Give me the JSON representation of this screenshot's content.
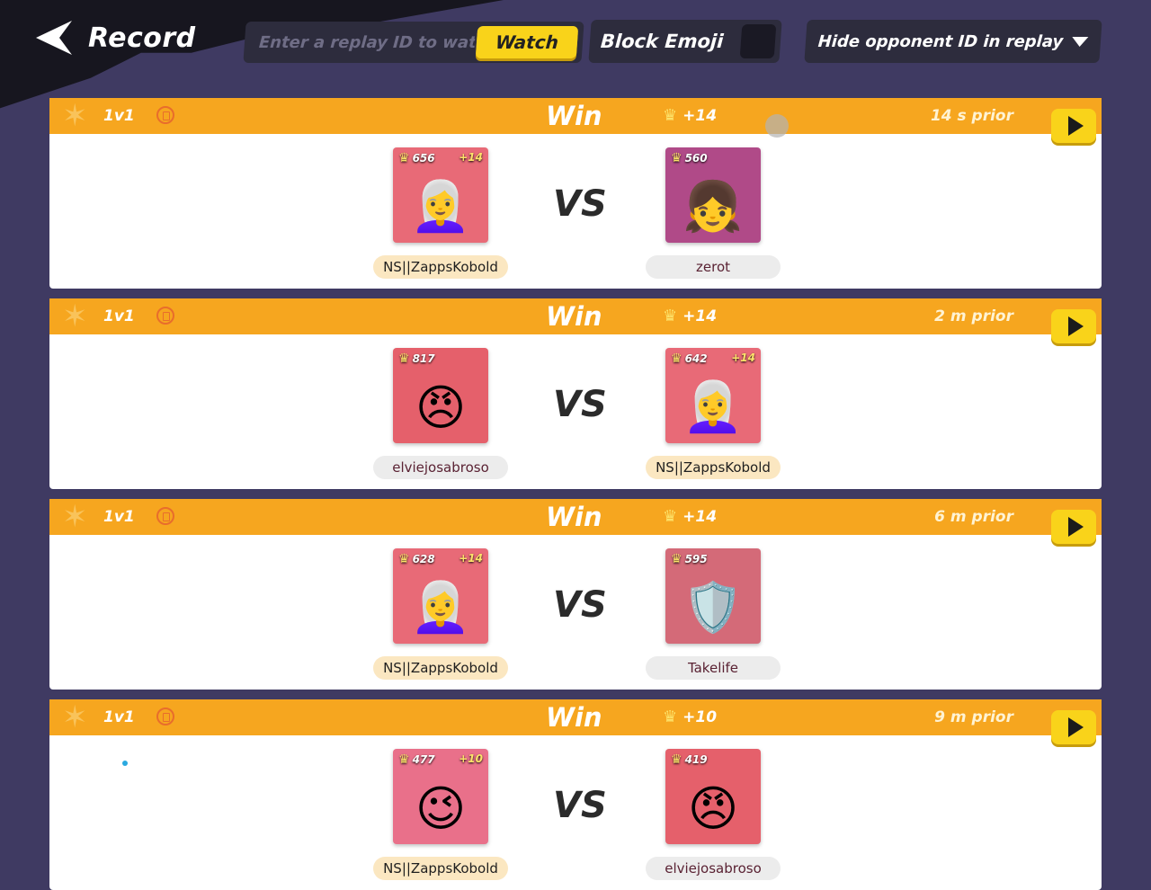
{
  "header": {
    "title": "Record",
    "search_placeholder": "Enter a replay ID to watch",
    "watch_label": "Watch",
    "block_emoji_label": "Block Emoji",
    "hide_opponent_label": "Hide opponent ID in replay"
  },
  "colors": {
    "background": "#3f3a62",
    "header_bar": "#f6a61f",
    "accent_yellow": "#f9d31a"
  },
  "records": [
    {
      "mode": "1v1",
      "result": "Win",
      "delta": "+14",
      "time": "14 s prior",
      "left": {
        "score": "656",
        "gain": "+14",
        "name": "NS||ZappsKobold",
        "is_self": true,
        "icon": "silver-hair-hero",
        "bg": "#e86a77",
        "face": "👩‍🦳"
      },
      "right": {
        "score": "560",
        "gain": "",
        "name": "zerot",
        "is_self": false,
        "icon": "blonde-cap-hero",
        "bg": "#b04a88",
        "face": "👧"
      }
    },
    {
      "mode": "1v1",
      "result": "Win",
      "delta": "+14",
      "time": "2 m prior",
      "left": {
        "score": "817",
        "gain": "",
        "name": "elviejosabroso",
        "is_self": false,
        "icon": "red-helmet-hero",
        "bg": "#e5606b",
        "face": "😠"
      },
      "right": {
        "score": "642",
        "gain": "+14",
        "name": "NS||ZappsKobold",
        "is_self": true,
        "icon": "silver-hair-hero",
        "bg": "#e86a77",
        "face": "👩‍🦳"
      }
    },
    {
      "mode": "1v1",
      "result": "Win",
      "delta": "+14",
      "time": "6 m prior",
      "left": {
        "score": "628",
        "gain": "+14",
        "name": "NS||ZappsKobold",
        "is_self": true,
        "icon": "silver-hair-hero",
        "bg": "#e86a77",
        "face": "👩‍🦳"
      },
      "right": {
        "score": "595",
        "gain": "",
        "name": "Takelife",
        "is_self": false,
        "icon": "armored-hero",
        "bg": "#d46a78",
        "face": "🛡️"
      }
    },
    {
      "mode": "1v1",
      "result": "Win",
      "delta": "+10",
      "time": "9 m prior",
      "left": {
        "score": "477",
        "gain": "+10",
        "name": "NS||ZappsKobold",
        "is_self": true,
        "icon": "teal-hair-hero",
        "bg": "#e9708a",
        "face": "😉"
      },
      "right": {
        "score": "419",
        "gain": "",
        "name": "elviejosabroso",
        "is_self": false,
        "icon": "red-helmet-hero",
        "bg": "#e5606b",
        "face": "😠"
      }
    }
  ]
}
